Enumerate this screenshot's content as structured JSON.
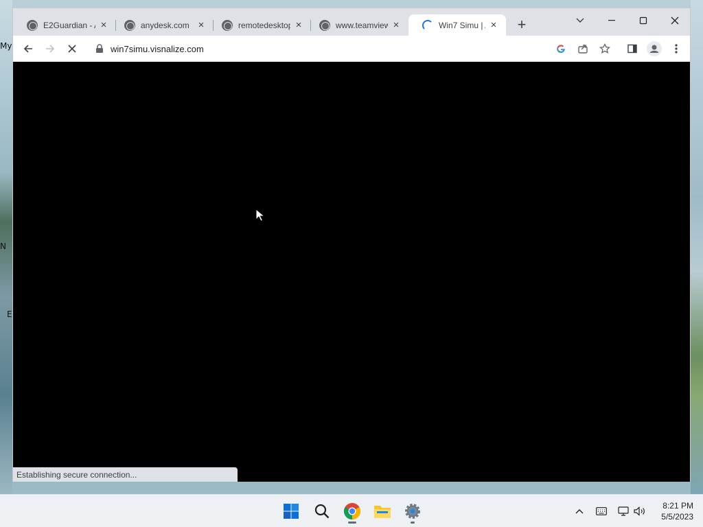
{
  "desktop": {
    "labels": [
      {
        "text": "My"
      },
      {
        "text": "N"
      },
      {
        "text": "E"
      }
    ]
  },
  "browser": {
    "tabs": [
      {
        "title": "E2Guardian - A",
        "active": false
      },
      {
        "title": "anydesk.com",
        "active": false
      },
      {
        "title": "remotedesktop",
        "active": false
      },
      {
        "title": "www.teamview",
        "active": false
      },
      {
        "title": "Win7 Simu | A",
        "active": true,
        "loading": true
      }
    ],
    "new_tab_label": "+",
    "address": "win7simu.visnalize.com",
    "status_text": "Establishing secure connection...",
    "colors": {
      "accent": "#1a73e8",
      "content_bg": "#000000"
    }
  },
  "taskbar": {
    "apps": [
      {
        "icon": "windows-start-icon"
      },
      {
        "icon": "search-icon"
      },
      {
        "icon": "chrome-icon",
        "active": true
      },
      {
        "icon": "file-explorer-icon"
      },
      {
        "icon": "settings-icon"
      }
    ],
    "tray": [
      {
        "icon": "chevron-up-icon"
      },
      {
        "icon": "keyboard-icon"
      },
      {
        "icon": "network-icon"
      },
      {
        "icon": "volume-icon"
      }
    ],
    "time": "8:21 PM",
    "date": "5/5/2023"
  }
}
